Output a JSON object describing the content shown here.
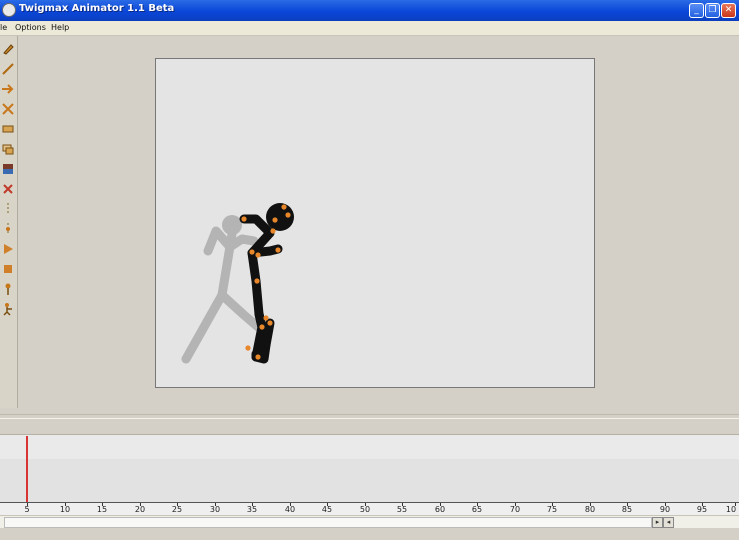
{
  "window": {
    "title": "Twigmax Animator 1.1 Beta",
    "minimize_glyph": "_",
    "maximize_glyph": "❐",
    "close_glyph": "✕"
  },
  "menu": {
    "items": [
      "le",
      "Options",
      "Help"
    ]
  },
  "toolbar": {
    "tools": [
      "pencil-icon",
      "line-icon",
      "arrow-icon",
      "scale-icon",
      "layer-icon",
      "copy-icon",
      "color-icon",
      "delete-icon",
      "frame-divider-icon",
      "insert-frame-icon",
      "play-icon",
      "stop-icon",
      "pin-icon",
      "add-figure-icon"
    ]
  },
  "timeline": {
    "current_frame": 5,
    "ruler_labels": [
      "5",
      "10",
      "15",
      "20",
      "25",
      "30",
      "35",
      "40",
      "45",
      "50",
      "55",
      "60",
      "65",
      "70",
      "75",
      "80",
      "85",
      "90",
      "95",
      "10"
    ]
  },
  "scrollbar": {
    "left_arrow": "◂",
    "right_arrow": "▸"
  },
  "colors": {
    "titlebar": "#0a46d8",
    "canvas": "#e4e4e4",
    "figure": "#111111",
    "joint": "#e8862a",
    "onion_skin": "#b4b4b4",
    "playhead": "#d93434"
  }
}
